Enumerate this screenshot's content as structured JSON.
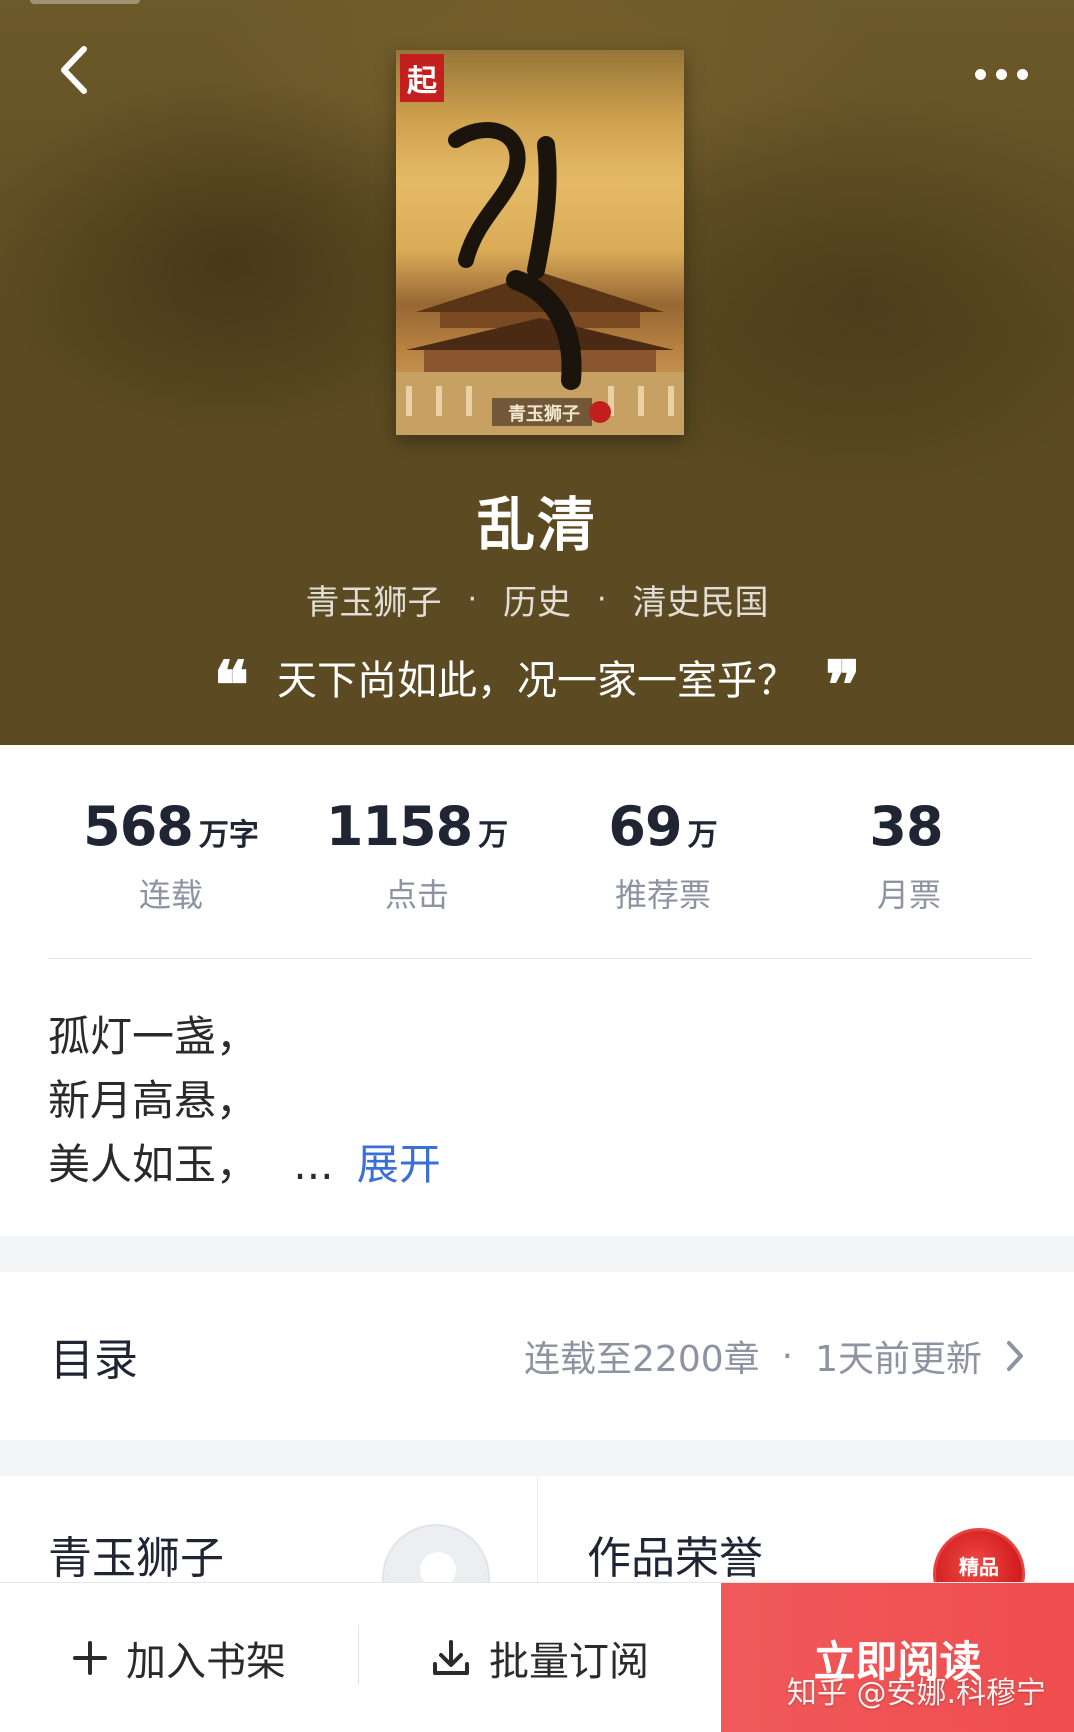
{
  "header": {
    "back_icon": "chevron-left-icon",
    "more_icon": "more-dots-icon"
  },
  "book": {
    "title": "乱清",
    "author": "青玉狮子",
    "category": "历史",
    "subcategory": "清史民国",
    "separator": "·",
    "quote": "天下尚如此，况一家一室乎？",
    "quote_open": "❝",
    "quote_close": "❞",
    "cover": {
      "publisher_mark": "起",
      "cover_title": "乱清",
      "cover_author": "青玉狮子"
    }
  },
  "stats": [
    {
      "value": "568",
      "unit": "万字",
      "label": "连载"
    },
    {
      "value": "1158",
      "unit": "万",
      "label": "点击"
    },
    {
      "value": "69",
      "unit": "万",
      "label": "推荐票"
    },
    {
      "value": "38",
      "unit": "",
      "label": "月票"
    }
  ],
  "intro": {
    "lines": [
      "孤灯一盏，",
      "新月高悬，",
      "美人如玉，"
    ],
    "ellipsis": "...",
    "expand_label": "展开"
  },
  "catalog": {
    "title": "目录",
    "status": "连载至2200章",
    "separator": "·",
    "updated": "1天前更新"
  },
  "author_card": {
    "name": "青玉狮子"
  },
  "honor_card": {
    "title": "作品荣誉",
    "badge_text": "精品"
  },
  "bottom_bar": {
    "add_shelf": "加入书架",
    "batch_subscribe": "批量订阅",
    "read_now": "立即阅读"
  },
  "watermark": "知乎 @安娜.科穆宁",
  "colors": {
    "accent_red": "#ef4d4e",
    "link_blue": "#3b6fd8",
    "hero_bg": "#5e4c23"
  }
}
